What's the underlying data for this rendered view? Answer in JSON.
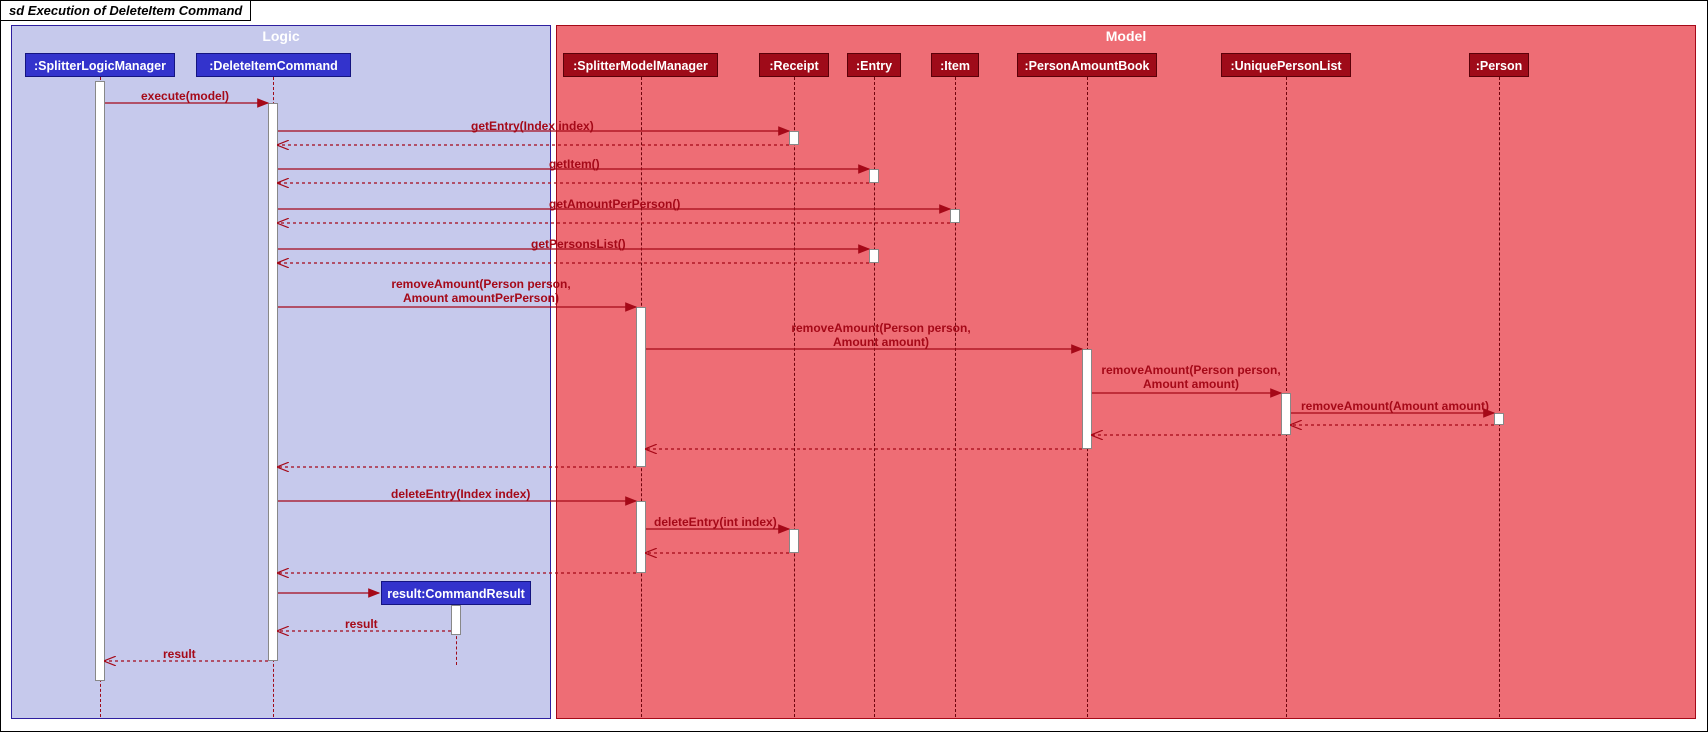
{
  "diagram": {
    "title": "sd Execution of DeleteItem Command",
    "packages": {
      "logic": "Logic",
      "model": "Model"
    },
    "participants": {
      "slm": ":SplitterLogicManager",
      "dic": ":DeleteItemCommand",
      "smm": ":SplitterModelManager",
      "rcp": ":Receipt",
      "ent": ":Entry",
      "itm": ":Item",
      "pab": ":PersonAmountBook",
      "upl": ":UniquePersonList",
      "psn": ":Person",
      "res": "result:CommandResult"
    },
    "messages": {
      "m1": "execute(model)",
      "m2": "getEntry(Index index)",
      "m3": "getItem()",
      "m4": "getAmountPerPerson()",
      "m5": "getPersonsList()",
      "m6a": "removeAmount(Person person,",
      "m6b": "Amount amountPerPerson)",
      "m7a": "removeAmount(Person person,",
      "m7b": "Amount amount)",
      "m8a": "removeAmount(Person person,",
      "m8b": "Amount amount)",
      "m9": "removeAmount(Amount amount)",
      "m10": "deleteEntry(Index index)",
      "m11": "deleteEntry(int index)",
      "m12": "result",
      "m13": "result"
    }
  }
}
